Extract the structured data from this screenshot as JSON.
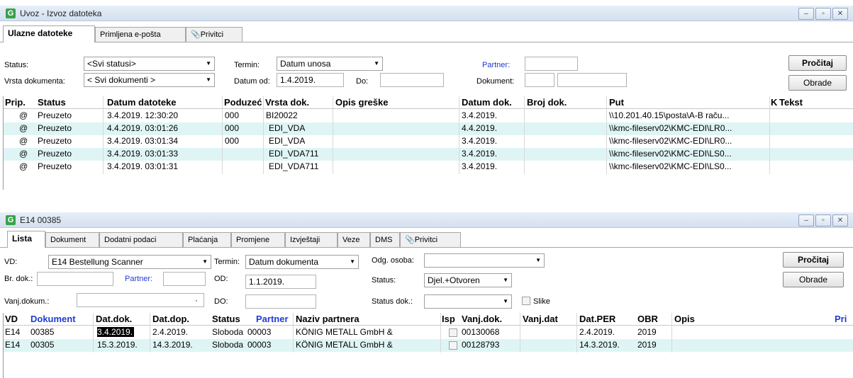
{
  "window1": {
    "title": "Uvoz - Izvoz datoteka",
    "tabs": [
      "Ulazne datoteke",
      "Primljena e-pošta",
      "Privitci"
    ],
    "status_label": "Status:",
    "status_value": "<Svi statusi>",
    "termin_label": "Termin:",
    "termin_value": "Datum unosa",
    "partner_label": "Partner:",
    "vrsta_label": "Vrsta dokumenta:",
    "vrsta_value": "< Svi dokumenti >",
    "datum_od_label": "Datum od:",
    "datum_od_value": "1.4.2019.",
    "do_label": "Do:",
    "dokument_label": "Dokument:",
    "procitaj": "Pročitaj",
    "obrade": "Obrade",
    "columns": [
      "Prip.",
      "Status",
      "Datum datoteke",
      "Poduzeć",
      "Vrsta dok.",
      "Opis greške",
      "Datum dok.",
      "Broj dok.",
      "Put",
      "K",
      "Tekst"
    ],
    "rows": [
      [
        "@",
        "Preuzeto",
        "3.4.2019. 12:30:20",
        "000",
        "BI20022",
        "",
        "3.4.2019.",
        "",
        "\\\\10.201.40.15\\posta\\A-B raču..."
      ],
      [
        "@",
        "Preuzeto",
        "4.4.2019. 03:01:26",
        "000",
        "EDI_VDA",
        "",
        "4.4.2019.",
        "",
        "\\\\kmc-fileserv02\\KMC-EDI\\LR0..."
      ],
      [
        "@",
        "Preuzeto",
        "3.4.2019. 03:01:34",
        "000",
        "EDI_VDA",
        "",
        "3.4.2019.",
        "",
        "\\\\kmc-fileserv02\\KMC-EDI\\LR0..."
      ],
      [
        "@",
        "Preuzeto",
        "3.4.2019. 03:01:33",
        "",
        "EDI_VDA711",
        "",
        "3.4.2019.",
        "",
        "\\\\kmc-fileserv02\\KMC-EDI\\LS0..."
      ],
      [
        "@",
        "Preuzeto",
        "3.4.2019. 03:01:31",
        "",
        "EDI_VDA711",
        "",
        "3.4.2019.",
        "",
        "\\\\kmc-fileserv02\\KMC-EDI\\LS0..."
      ]
    ]
  },
  "window2": {
    "title": "E14 00385",
    "tabs": [
      "Lista",
      "Dokument",
      "Dodatni podaci",
      "Plaćanja",
      "Promjene",
      "Izvještaji",
      "Veze",
      "DMS",
      "Privitci"
    ],
    "vd_label": "VD:",
    "vd_value": "E14  Bestellung Scanner",
    "termin_label": "Termin:",
    "termin_value": "Datum dokumenta",
    "odg_label": "Odg. osoba:",
    "br_dok_label": "Br. dok.:",
    "partner_label": "Partner:",
    "od_label": "OD:",
    "od_value": "1.1.2019.",
    "status_label": "Status:",
    "status_value": "Djel.+Otvoren",
    "vanj_label": "Vanj.dokum.:",
    "dot": "·",
    "do_label": "DO:",
    "status_dok_label": "Status dok.:",
    "slike_label": "Slike",
    "procitaj": "Pročitaj",
    "obrade": "Obrade",
    "columns": [
      "VD",
      "Dokument",
      "Dat.dok.",
      "Dat.dop.",
      "Status",
      "Partner",
      "Naziv partnera",
      "Isp",
      "Vanj.dok.",
      "Vanj.dat",
      "Dat.PER",
      "OBR",
      "Opis",
      "Pri"
    ],
    "rows": [
      [
        "E14",
        "00385",
        "3.4.2019.",
        "2.4.2019.",
        "Sloboda",
        "00003",
        "KÖNIG METALL GmbH &",
        "",
        "00130068",
        "",
        "2.4.2019.",
        "2019",
        ""
      ],
      [
        "E14",
        "00305",
        "15.3.2019.",
        "14.3.2019.",
        "Sloboda",
        "00003",
        "KÖNIG METALL GmbH &",
        "",
        "00128793",
        "",
        "14.3.2019.",
        "2019",
        ""
      ]
    ]
  }
}
